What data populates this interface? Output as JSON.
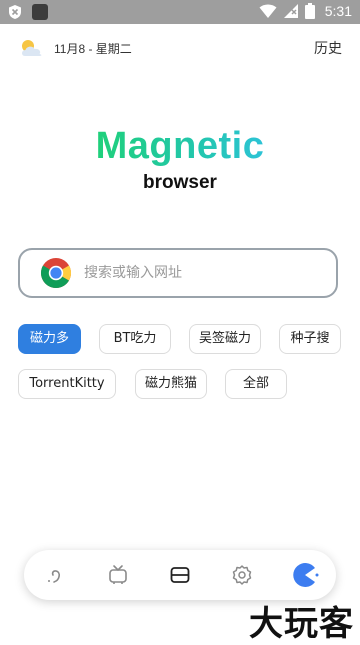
{
  "status_bar": {
    "time": "5:31"
  },
  "header": {
    "date": "11月8 - 星期二",
    "history_label": "历史"
  },
  "logo": {
    "title": "Magnetic",
    "subtitle": "browser"
  },
  "search": {
    "placeholder": "搜索或输入网址",
    "value": ""
  },
  "engines": [
    {
      "label": "磁力多",
      "active": true
    },
    {
      "label": "BT吃力",
      "active": false
    },
    {
      "label": "吴签磁力",
      "active": false
    },
    {
      "label": "种子搜",
      "active": false
    },
    {
      "label": "TorrentKitty",
      "active": false
    },
    {
      "label": "磁力熊猫",
      "active": false
    },
    {
      "label": "全部",
      "active": false
    }
  ],
  "bottom_nav": [
    "back-icon",
    "tv-icon",
    "tabs-icon",
    "settings-icon",
    "pacman-icon"
  ],
  "watermark": "大玩客",
  "colors": {
    "accent": "#2f7fe0",
    "logo_gradient_start": "#1fd07a",
    "logo_gradient_end": "#2cc3d6"
  }
}
